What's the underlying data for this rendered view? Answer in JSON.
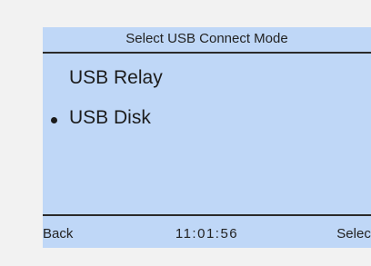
{
  "screen": {
    "title": "Select USB Connect Mode",
    "menu_items": [
      {
        "label": "USB Relay",
        "selected": false
      },
      {
        "label": "USB Disk",
        "selected": true
      }
    ],
    "footer": {
      "left_softkey": "Back",
      "clock": "11:01:56",
      "right_softkey": "Select"
    }
  },
  "colors": {
    "background": "#f2f2f2",
    "screen": "#bfd7f7",
    "rule": "#2a2a2a",
    "text": "#1c1c1c"
  }
}
